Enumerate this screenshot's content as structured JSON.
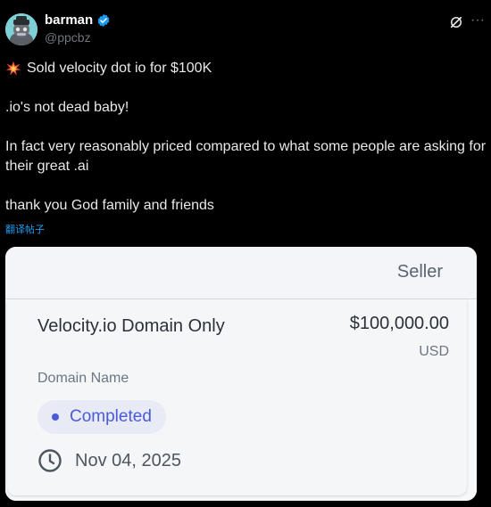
{
  "author": {
    "display_name": "barman",
    "handle": "@ppcbz",
    "verified": true,
    "avatar_icon": "monkey-avatar"
  },
  "header_icons": {
    "grok": "grok-icon",
    "more": "more-options-icon"
  },
  "post": {
    "line1_text": "Sold velocity dot io for $100K",
    "line1_emoji": "collision-emoji",
    "line2": ".io's not dead baby!",
    "line3": "In fact very reasonably priced compared to what some people are asking for their great .ai",
    "line4": "thank you God family and friends"
  },
  "translate_label": "翻译帖子",
  "card": {
    "column_header": "Seller",
    "product_name": "Velocity.io Domain Only",
    "price": "$100,000.00",
    "currency": "USD",
    "subtitle": "Domain Name",
    "status": "Completed",
    "date": "Nov 04, 2025"
  },
  "colors": {
    "background": "#000000",
    "link": "#1d9bf0",
    "verified": "#1d9bf0",
    "status_accent": "#4a5ad8",
    "status_bg": "#e8eaf6"
  }
}
